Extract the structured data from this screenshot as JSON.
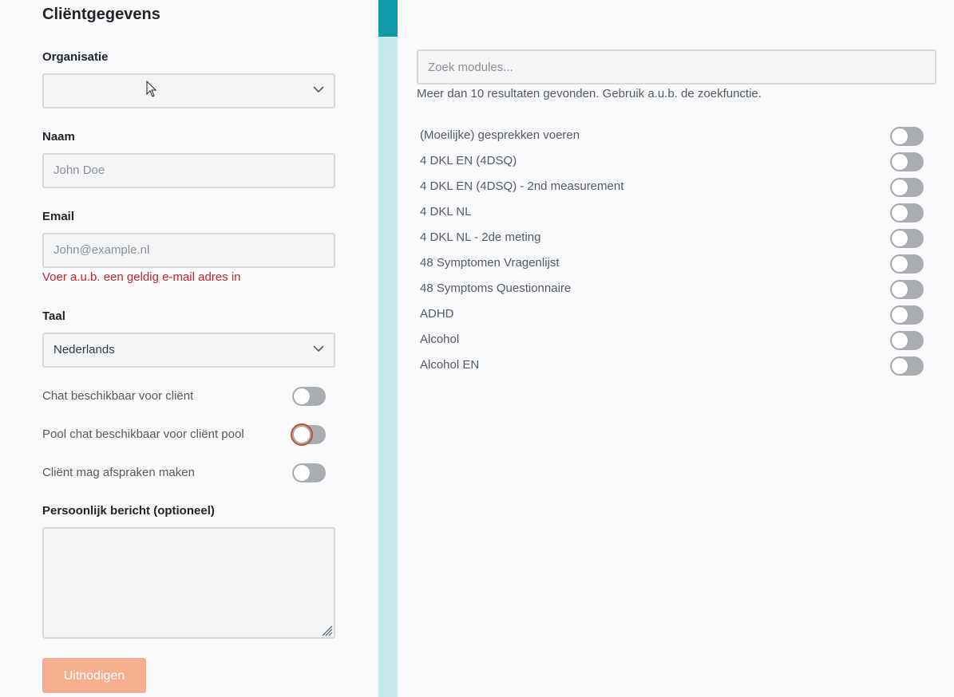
{
  "form": {
    "title": "Cliëntgegevens",
    "organisation": {
      "label": "Organisatie",
      "value": ""
    },
    "name": {
      "label": "Naam",
      "placeholder": "John Doe",
      "value": ""
    },
    "email": {
      "label": "Email",
      "placeholder": "John@example.nl",
      "value": "",
      "error": "Voer a.u.b. een geldig e-mail adres in"
    },
    "language": {
      "label": "Taal",
      "value": "Nederlands"
    },
    "toggles": [
      {
        "label": "Chat beschikbaar voor cliënt",
        "on": false
      },
      {
        "label": "Pool chat beschikbaar voor cliënt pool",
        "on": false,
        "focused": true
      },
      {
        "label": "Cliënt mag afspraken maken",
        "on": false
      }
    ],
    "message": {
      "label": "Persoonlijk bericht (optioneel)",
      "value": ""
    },
    "submit_label": "Uitnodigen"
  },
  "modules": {
    "search_placeholder": "Zoek modules...",
    "hint": "Meer dan 10 resultaten gevonden. Gebruik a.u.b. de zoekfunctie.",
    "items": [
      {
        "label": "(Moeilijke) gesprekken voeren",
        "on": false
      },
      {
        "label": "4 DKL EN (4DSQ)",
        "on": false
      },
      {
        "label": "4 DKL EN (4DSQ) - 2nd measurement",
        "on": false
      },
      {
        "label": "4 DKL NL",
        "on": false
      },
      {
        "label": "4 DKL NL - 2de meting",
        "on": false
      },
      {
        "label": "48 Symptomen Vragenlijst",
        "on": false
      },
      {
        "label": "48 Symptoms Questionnaire",
        "on": false
      },
      {
        "label": "ADHD",
        "on": false
      },
      {
        "label": "Alcohol",
        "on": false
      },
      {
        "label": "Alcohol EN",
        "on": false
      }
    ]
  },
  "colors": {
    "accent_teal": "#0e9aa7",
    "divider": "#c8e8ec",
    "button": "#f7ae8f",
    "error": "#c0262d",
    "toggle_off": "#a9adb2",
    "focus_ring": "#c0522a"
  },
  "icons": {
    "select_arrow": "chevron-down-icon",
    "resize_handle": "resize-grip-icon",
    "pointer": "mouse-pointer-icon"
  }
}
